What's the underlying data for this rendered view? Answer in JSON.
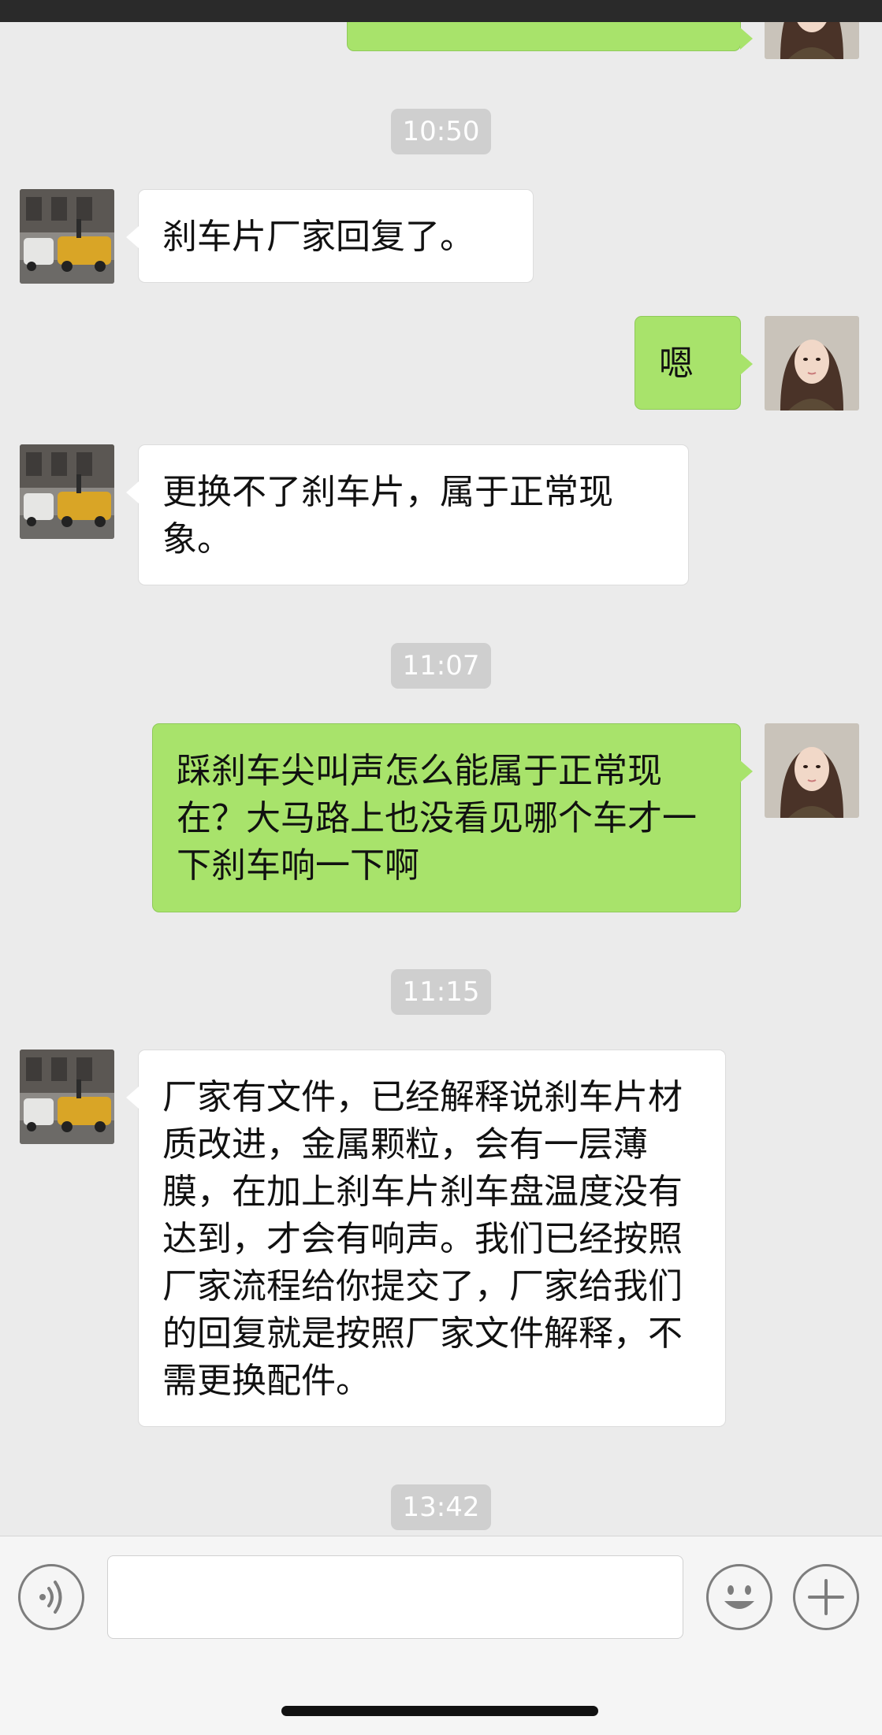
{
  "messages": {
    "ts1": "10:50",
    "m1": "刹车片厂家回复了。",
    "m2": "嗯",
    "m3": "更换不了刹车片，属于正常现象。",
    "ts2": "11:07",
    "m4": "踩刹车尖叫声怎么能属于正常现在？大马路上也没看见哪个车才一下刹车响一下啊",
    "ts3": "11:15",
    "m5": "厂家有文件，已经解释说刹车片材质改进，金属颗粒，会有一层薄膜，在加上刹车片刹车盘温度没有达到，才会有响声。我们已经按照厂家流程给你提交了，厂家给我们的回复就是按照厂家文件解释，不需更换配件。",
    "ts4": "13:42"
  },
  "input": {
    "value": "",
    "placeholder": ""
  },
  "icons": {
    "voice": "voice-icon",
    "emoji": "emoji-icon",
    "plus": "plus-icon"
  },
  "colors": {
    "outgoing_bubble": "#a8e36b",
    "incoming_bubble": "#ffffff",
    "background": "#ebebeb"
  }
}
